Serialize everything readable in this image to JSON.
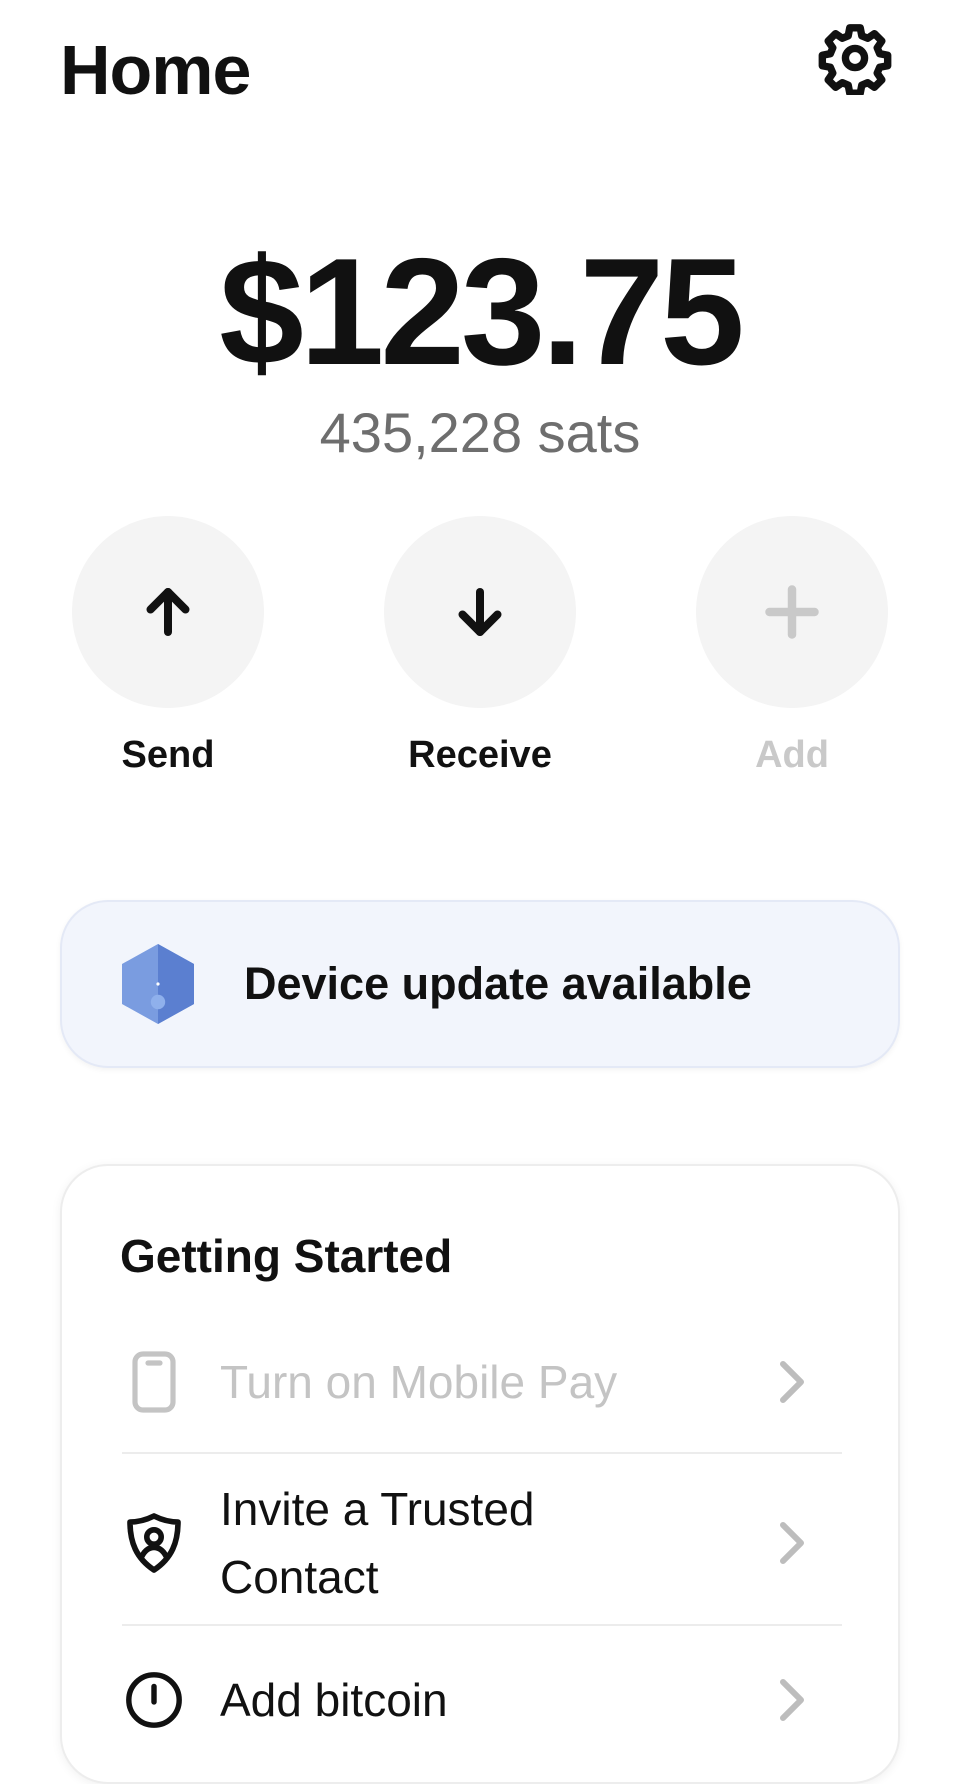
{
  "header": {
    "title": "Home",
    "settings_icon": "gear-icon"
  },
  "balance": {
    "fiat": "$123.75",
    "sats": "435,228 sats"
  },
  "actions": [
    {
      "label": "Send",
      "icon": "arrow-up-icon",
      "enabled": true
    },
    {
      "label": "Receive",
      "icon": "arrow-down-icon",
      "enabled": true
    },
    {
      "label": "Add",
      "icon": "plus-icon",
      "enabled": false
    }
  ],
  "banner": {
    "text": "Device update available",
    "icon": "device-hexagon-icon",
    "accent_color": "#5b7fd0"
  },
  "getting_started": {
    "title": "Getting Started",
    "items": [
      {
        "label": "Turn on Mobile Pay",
        "icon": "phone-icon",
        "enabled": false
      },
      {
        "label_line1": "Invite a Trusted",
        "label_line2": "Contact",
        "icon": "shield-user-icon",
        "enabled": true
      },
      {
        "label": "Add bitcoin",
        "icon": "clock-icon",
        "enabled": true
      }
    ]
  },
  "colors": {
    "text_primary": "#111111",
    "text_secondary": "#6e6e6e",
    "text_disabled": "#c9c9c9",
    "action_bg": "#f4f4f4",
    "banner_bg": "#f2f5fc"
  }
}
